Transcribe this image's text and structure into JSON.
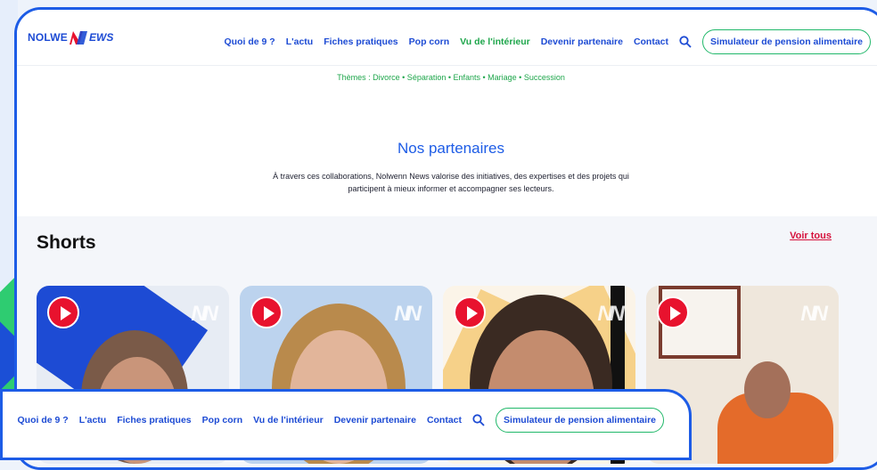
{
  "brand": {
    "nolwe": "NOLWE",
    "news": "EWS"
  },
  "nav": {
    "items": [
      "Quoi de 9 ?",
      "L'actu",
      "Fiches pratiques",
      "Pop corn",
      "Vu de l'intérieur",
      "Devenir partenaire",
      "Contact"
    ],
    "simulator": "Simulateur de pension alimentaire"
  },
  "themes": "Thèmes : Divorce • Séparation • Enfants • Mariage • Succession",
  "partners": {
    "title": "Nos partenaires",
    "text": "À travers ces collaborations, Nolwenn News valorise des initiatives, des expertises et des projets qui participent à mieux informer et accompagner ses lecteurs."
  },
  "shorts": {
    "title": "Shorts",
    "see_all": "Voir tous",
    "watermark": "NN"
  },
  "colors": {
    "primary": "#1d5ce6",
    "accent": "#1ea64b",
    "red": "#d6113c"
  }
}
